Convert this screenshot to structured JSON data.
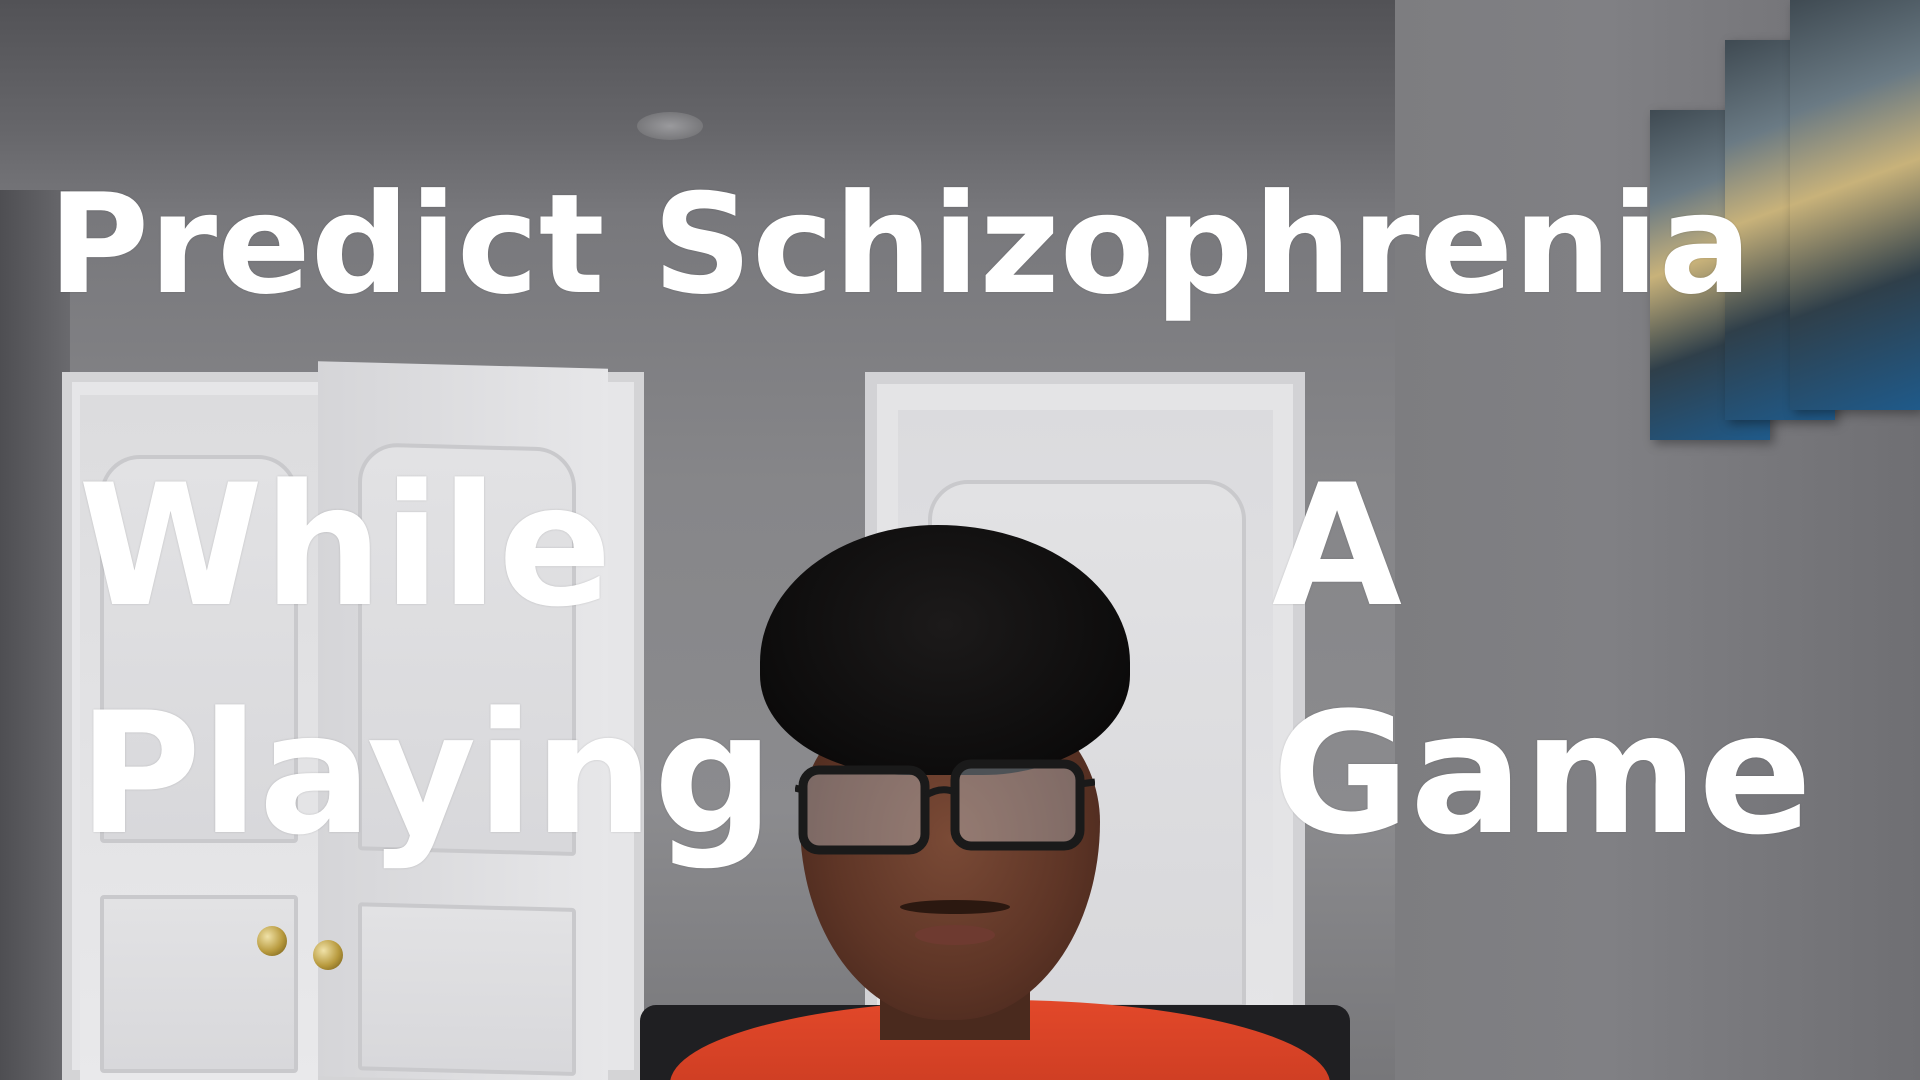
{
  "overlay_text": {
    "title": "Predict Schizophrenia",
    "word_while": "While",
    "word_a": "A",
    "word_playing": "Playing",
    "word_game": "Game"
  },
  "scene": {
    "description_elements": [
      "room-wall",
      "double-door",
      "single-door",
      "wall-art",
      "person"
    ],
    "colors": {
      "text": "#ffffff",
      "wall": "#85858a",
      "door": "#e4e4e6",
      "shirt": "#d8422a",
      "hair": "#0d0c0c"
    }
  }
}
